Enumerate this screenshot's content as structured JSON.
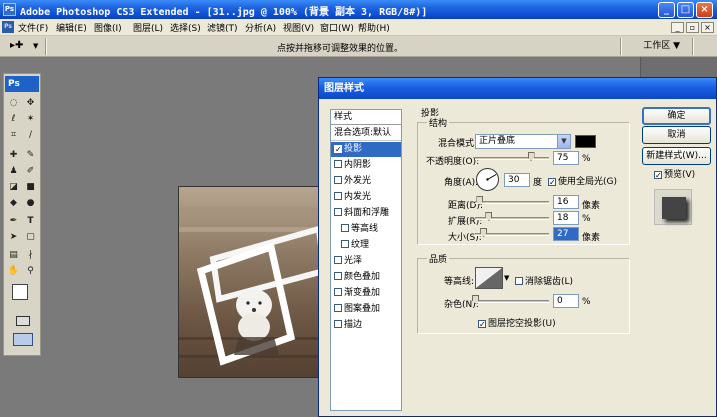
{
  "window": {
    "title": "Adobe Photoshop CS3 Extended - [31..jpg @ 100% (背景 副本 3, RGB/8#)]",
    "app_badge": "Ps",
    "minimize": "_",
    "maximize": "□",
    "close": "×"
  },
  "menu": {
    "items": [
      "文件(F)",
      "编辑(E)",
      "图像(I)",
      "图层(L)",
      "选择(S)",
      "滤镜(T)",
      "分析(A)",
      "视图(V)",
      "窗口(W)",
      "帮助(H)"
    ]
  },
  "options_bar": {
    "tool_glyph": "▸✚",
    "hint": "点按并拖移可调整效果的位置。",
    "workspace": "工作区 ▼"
  },
  "toolbox": {
    "badge": "Ps"
  },
  "dialog": {
    "title": "图层样式",
    "style_list": {
      "header": "样式",
      "blend_item": "混合选项:默认",
      "items": [
        {
          "label": "投影",
          "checked": true,
          "selected": true,
          "indent": false
        },
        {
          "label": "内阴影",
          "checked": false,
          "selected": false,
          "indent": false
        },
        {
          "label": "外发光",
          "checked": false,
          "selected": false,
          "indent": false
        },
        {
          "label": "内发光",
          "checked": false,
          "selected": false,
          "indent": false
        },
        {
          "label": "斜面和浮雕",
          "checked": false,
          "selected": false,
          "indent": false
        },
        {
          "label": "等高线",
          "checked": false,
          "selected": false,
          "indent": true
        },
        {
          "label": "纹理",
          "checked": false,
          "selected": false,
          "indent": true
        },
        {
          "label": "光泽",
          "checked": false,
          "selected": false,
          "indent": false
        },
        {
          "label": "颜色叠加",
          "checked": false,
          "selected": false,
          "indent": false
        },
        {
          "label": "渐变叠加",
          "checked": false,
          "selected": false,
          "indent": false
        },
        {
          "label": "图案叠加",
          "checked": false,
          "selected": false,
          "indent": false
        },
        {
          "label": "描边",
          "checked": false,
          "selected": false,
          "indent": false
        }
      ]
    },
    "shadow": {
      "section_title": "投影",
      "structure_title": "结构",
      "blend_mode_label": "混合模式:",
      "blend_mode_value": "正片叠底",
      "color_hex": "#000000",
      "opacity_label": "不透明度(O):",
      "opacity_value": "75",
      "opacity_fraction": 0.75,
      "percent": "%",
      "angle_label": "角度(A):",
      "angle_value": "30",
      "angle_unit": "度",
      "global_light_label": "使用全局光(G)",
      "global_light_checked": true,
      "distance_label": "距离(D):",
      "distance_value": "16",
      "distance_fraction": 0.06,
      "size_unit": "像素",
      "spread_label": "扩展(R):",
      "spread_value": "18",
      "spread_fraction": 0.18,
      "size_label": "大小(S):",
      "size_value": "27",
      "size_fraction": 0.11,
      "quality_title": "品质",
      "contour_label": "等高线:",
      "antialias_label": "消除锯齿(L)",
      "antialias_checked": false,
      "noise_label": "杂色(N):",
      "noise_value": "0",
      "noise_fraction": 0,
      "knockout_label": "图层挖空投影(U)",
      "knockout_checked": true
    },
    "buttons": {
      "ok": "确定",
      "cancel": "取消",
      "new_style": "新建样式(W)...",
      "preview_label": "预览(V)",
      "preview_checked": true
    }
  },
  "colors": {
    "titlebar": "#0a4bd1",
    "selection": "#316ac5",
    "dialog_bg": "#ece9d8",
    "canvas_bg": "#7a7a7a"
  }
}
